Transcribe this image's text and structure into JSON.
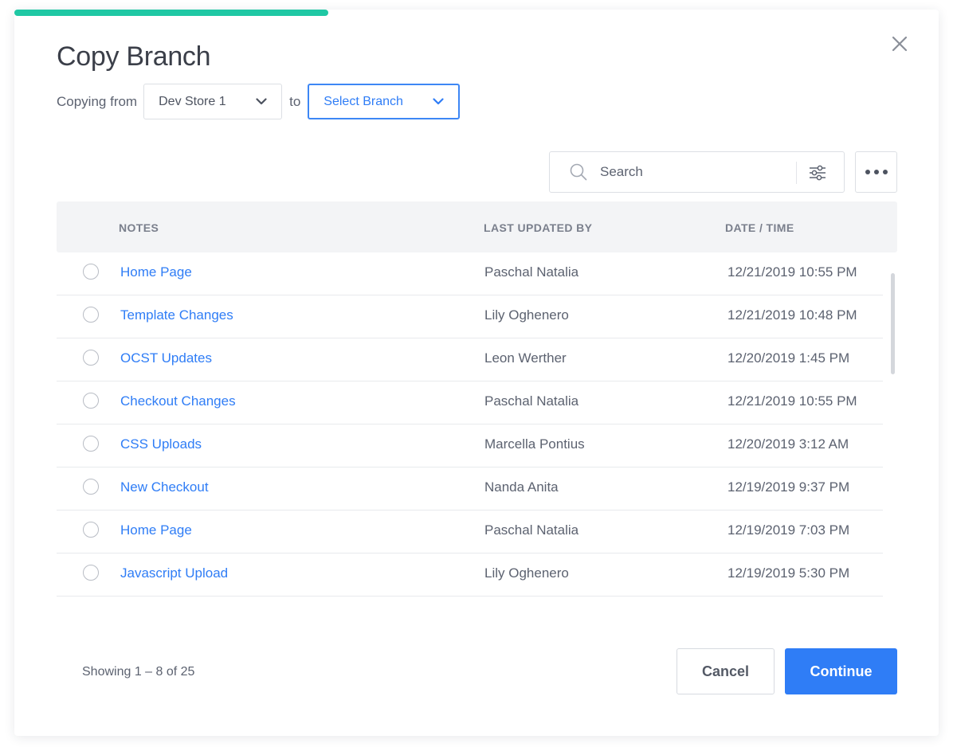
{
  "modal": {
    "title": "Copy Branch",
    "progress_percent": 34,
    "colors": {
      "accent": "#2f7df6",
      "progress": "#1fc8a4"
    }
  },
  "copy_row": {
    "from_label": "Copying from",
    "from_value": "Dev Store 1",
    "to_label": "to",
    "branch_placeholder": "Select Branch"
  },
  "toolbar": {
    "search_placeholder": "Search",
    "search_icon": "search-icon",
    "filter_icon": "sliders-icon",
    "more_icon": "more-horizontal-icon"
  },
  "table": {
    "columns": [
      "NOTES",
      "LAST UPDATED BY",
      "DATE / TIME"
    ],
    "rows": [
      {
        "note": "Home Page",
        "user": "Paschal Natalia",
        "date": "12/21/2019 10:55 PM"
      },
      {
        "note": "Template Changes",
        "user": "Lily Oghenero",
        "date": "12/21/2019 10:48 PM"
      },
      {
        "note": "OCST Updates",
        "user": "Leon Werther",
        "date": "12/20/2019 1:45 PM"
      },
      {
        "note": "Checkout Changes",
        "user": "Paschal Natalia",
        "date": "12/21/2019 10:55 PM"
      },
      {
        "note": "CSS Uploads",
        "user": "Marcella Pontius",
        "date": "12/20/2019 3:12 AM"
      },
      {
        "note": "New Checkout",
        "user": "Nanda Anita",
        "date": "12/19/2019 9:37 PM"
      },
      {
        "note": "Home Page",
        "user": "Paschal Natalia",
        "date": "12/19/2019 7:03 PM"
      },
      {
        "note": "Javascript Upload",
        "user": "Lily Oghenero",
        "date": "12/19/2019 5:30 PM"
      }
    ]
  },
  "footer": {
    "showing": "Showing 1 – 8 of 25",
    "cancel_label": "Cancel",
    "continue_label": "Continue"
  }
}
